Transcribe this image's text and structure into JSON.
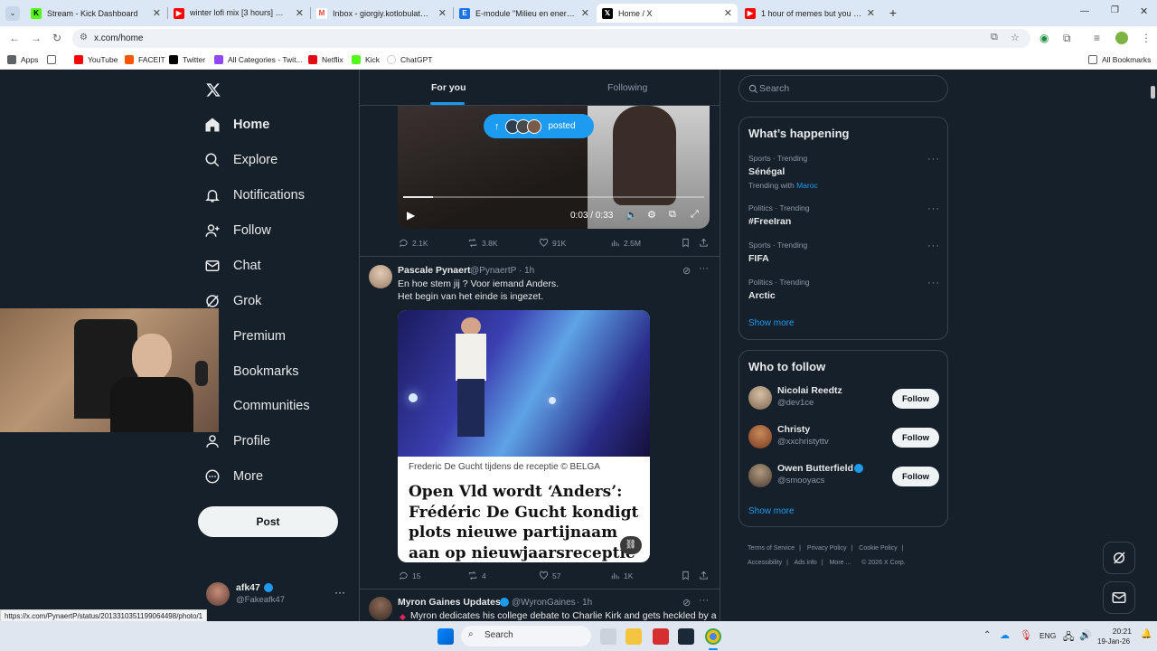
{
  "browser": {
    "tabs": [
      {
        "title": "Stream - Kick Dashboard",
        "favicon_color": "#53fc18",
        "favicon": "K"
      },
      {
        "title": "winter lofi mix [3 hours] ❄️ rela",
        "favicon_color": "#ff0000",
        "favicon": "▶"
      },
      {
        "title": "Inbox - giorgiy.kotlobulat@vda",
        "favicon_color": "#ea4335",
        "favicon": "M"
      },
      {
        "title": "E-module \"Milieu en energie in",
        "favicon_color": "#1a73e8",
        "favicon": "E"
      },
      {
        "title": "Home / X",
        "favicon_color": "#000000",
        "favicon": "𝕏"
      },
      {
        "title": "1 hour of memes but you will la",
        "favicon_color": "#ff0000",
        "favicon": "▶"
      }
    ],
    "url": "x.com/home",
    "bookmarks": [
      {
        "label": "Apps",
        "color": "#5f6368"
      },
      {
        "label": "YouTube",
        "color": "#ff0000"
      },
      {
        "label": "FACEIT",
        "color": "#ff5500"
      },
      {
        "label": "Twitter",
        "color": "#000000"
      },
      {
        "label": "All Categories - Twit...",
        "color": "#9146ff"
      },
      {
        "label": "Netflix",
        "color": "#e50914"
      },
      {
        "label": "Kick",
        "color": "#53fc18"
      },
      {
        "label": "ChatGPT",
        "color": "#ffffff"
      }
    ],
    "all_bookmarks": "All Bookmarks",
    "status_url": "https://x.com/PynaertP/status/2013310351199064498/photo/1"
  },
  "sidebar": {
    "items": [
      {
        "label": "Home",
        "icon": "home-icon"
      },
      {
        "label": "Explore",
        "icon": "search-icon"
      },
      {
        "label": "Notifications",
        "icon": "bell-icon"
      },
      {
        "label": "Follow",
        "icon": "add-user-icon"
      },
      {
        "label": "Chat",
        "icon": "mail-icon"
      },
      {
        "label": "Grok",
        "icon": "grok-icon"
      },
      {
        "label": "Premium",
        "icon": "x-icon"
      },
      {
        "label": "Bookmarks",
        "icon": "bookmark-icon"
      },
      {
        "label": "Communities",
        "icon": "people-icon"
      },
      {
        "label": "Profile",
        "icon": "user-icon"
      },
      {
        "label": "More",
        "icon": "more-circle-icon"
      }
    ],
    "post_button": "Post",
    "account": {
      "name": "afk47",
      "handle": "@Fakeafk47"
    }
  },
  "feed": {
    "tabs": [
      {
        "label": "For you",
        "active": true
      },
      {
        "label": "Following",
        "active": false
      }
    ],
    "posted_pill": "posted",
    "video": {
      "time": "0:03 / 0:33",
      "progress": 0.1
    },
    "post1_metrics": {
      "replies": "2.1K",
      "reposts": "3.8K",
      "likes": "91K",
      "views": "2.5M"
    },
    "post2": {
      "name": "Pascale Pynaert",
      "handle": "@PynaertP",
      "time": "· 1h",
      "text_line1": "En hoe stem jij ? Voor iemand Anders.",
      "text_line2": "Het begin van het einde is ingezet.",
      "card_caption": "Frederic De Gucht tijdens de receptie © BELGA",
      "card_title": "Open Vld wordt ‘Anders’: Frédéric De Gucht kondigt plots nieuwe partijnaam aan op nieuwjaarsreceptie",
      "metrics": {
        "replies": "15",
        "reposts": "4",
        "likes": "57",
        "views": "1K"
      }
    },
    "post3": {
      "name": "Myron Gaines Updates",
      "handle": "@WyronGaines",
      "time": "· 1h",
      "text": "Myron dedicates his college debate to Charlie Kirk and gets heckled by a"
    }
  },
  "right": {
    "search_placeholder": "Search",
    "whats_happening": "What’s happening",
    "trends": [
      {
        "category": "Sports · Trending",
        "name": "Sénégal",
        "extra_prefix": "Trending with",
        "extra_link": "Maroc"
      },
      {
        "category": "Politics · Trending",
        "name": "#FreeIran"
      },
      {
        "category": "Sports · Trending",
        "name": "FIFA"
      },
      {
        "category": "Politics · Trending",
        "name": "Arctic"
      }
    ],
    "show_more": "Show more",
    "who_to_follow": "Who to follow",
    "suggestions": [
      {
        "name": "Nicolai Reedtz",
        "handle": "@dev1ce",
        "verified": false,
        "button": "Follow"
      },
      {
        "name": "Christy",
        "handle": "@xxchristyttv",
        "verified": false,
        "button": "Follow"
      },
      {
        "name": "Owen Butterfield",
        "handle": "@smooyacs",
        "verified": true,
        "button": "Follow"
      }
    ],
    "show_more_2": "Show more",
    "footer": [
      "Terms of Service",
      "Privacy Policy",
      "Cookie Policy",
      "Accessibility",
      "Ads info",
      "More ...",
      "© 2026 X Corp."
    ]
  },
  "taskbar": {
    "search": "Search",
    "lang": "ENG",
    "time": "20:21",
    "date": "19-Jan-26"
  },
  "colors": {
    "bg": "#15202b",
    "accent": "#1d9bf0",
    "border": "#38444d",
    "muted": "#8b98a5"
  }
}
